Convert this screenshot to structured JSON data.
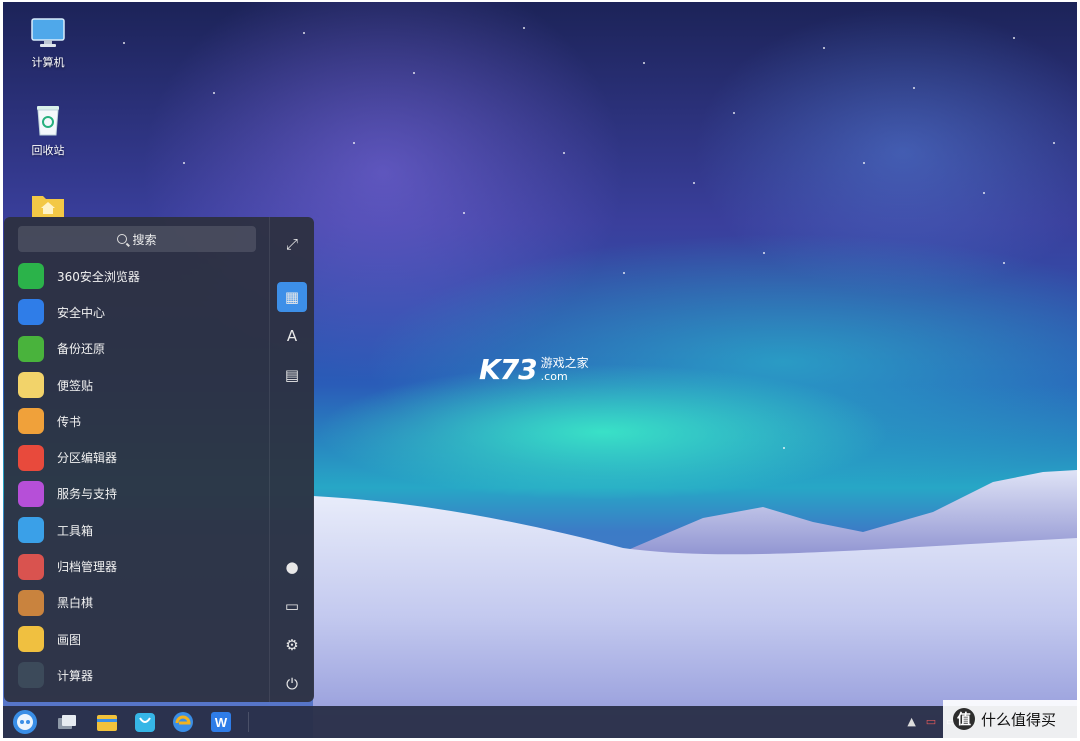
{
  "desktop": {
    "icons": [
      {
        "label": "计算机",
        "icon": "monitor-icon"
      },
      {
        "label": "回收站",
        "icon": "recycle-bin-icon"
      },
      {
        "label": "",
        "icon": "home-folder-icon"
      }
    ],
    "watermark": {
      "logo": "K73",
      "top": "游戏之家",
      "bottom": ".com"
    }
  },
  "start_menu": {
    "search_placeholder": "搜索",
    "apps": [
      {
        "label": "360安全浏览器",
        "icon": "browser-360-icon",
        "color": "#2bb34a"
      },
      {
        "label": "安全中心",
        "icon": "shield-icon",
        "color": "#2f7de8"
      },
      {
        "label": "备份还原",
        "icon": "backup-icon",
        "color": "#49b33c"
      },
      {
        "label": "便签贴",
        "icon": "sticky-note-icon",
        "color": "#f2d36a"
      },
      {
        "label": "传书",
        "icon": "paper-plane-icon",
        "color": "#f0a13a"
      },
      {
        "label": "分区编辑器",
        "icon": "partition-editor-icon",
        "color": "#e84a3c"
      },
      {
        "label": "服务与支持",
        "icon": "support-icon",
        "color": "#b64fd8"
      },
      {
        "label": "工具箱",
        "icon": "toolbox-icon",
        "color": "#3aa0e8"
      },
      {
        "label": "归档管理器",
        "icon": "archive-manager-icon",
        "color": "#d9534f"
      },
      {
        "label": "黑白棋",
        "icon": "othello-icon",
        "color": "#c9833e"
      },
      {
        "label": "画图",
        "icon": "paint-icon",
        "color": "#f0c040"
      },
      {
        "label": "计算器",
        "icon": "calculator-icon",
        "color": "#3c4a5a"
      }
    ],
    "side_buttons": [
      {
        "icon": "expand-icon",
        "glyph": "⤢"
      },
      {
        "icon": "category-view-icon",
        "glyph": "▦",
        "active": true
      },
      {
        "icon": "letter-sort-icon",
        "glyph": "A"
      },
      {
        "icon": "function-sort-icon",
        "glyph": "▤"
      },
      {
        "icon": "user-icon",
        "glyph": "●"
      },
      {
        "icon": "computer-icon",
        "glyph": "▭"
      },
      {
        "icon": "settings-icon",
        "glyph": "⚙"
      },
      {
        "icon": "power-icon",
        "glyph": "⏻"
      }
    ]
  },
  "taskbar": {
    "items": [
      {
        "icon": "start-menu-icon",
        "color": "#3a8ee6"
      },
      {
        "icon": "multitask-view-icon",
        "color": "#c9d3df"
      },
      {
        "icon": "file-manager-icon",
        "color": "#f2c23a"
      },
      {
        "icon": "software-store-icon",
        "color": "#36b6e6"
      },
      {
        "icon": "browser-icon",
        "color": "#f2b21e"
      },
      {
        "icon": "wps-writer-icon",
        "color": "#2f7de8"
      }
    ],
    "tray": [
      "▲",
      "▭",
      "▭",
      "▭"
    ],
    "brand": {
      "mark": "值",
      "text": "什么值得买"
    }
  }
}
